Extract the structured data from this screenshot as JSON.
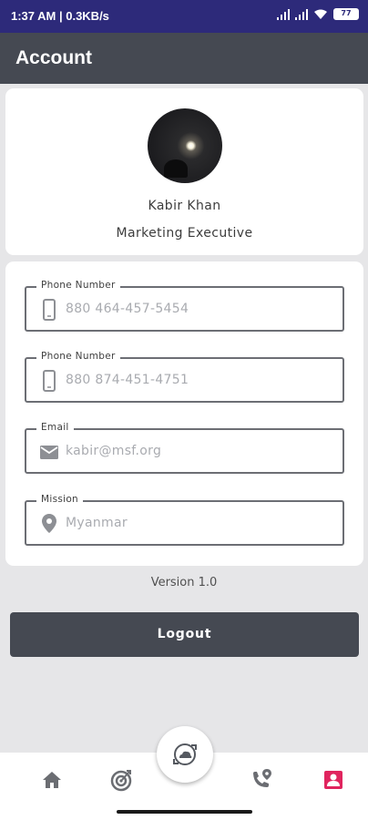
{
  "status_bar": {
    "time": "1:37 AM | 0.3KB/s",
    "battery": "77"
  },
  "app_bar": {
    "title": "Account"
  },
  "profile": {
    "name": "Kabir Khan",
    "role": "Marketing Executive"
  },
  "fields": [
    {
      "label": "Phone Number",
      "value": "880 464-457-5454",
      "icon": "phone-icon"
    },
    {
      "label": "Phone Number",
      "value": "880 874-451-4751",
      "icon": "phone-icon"
    },
    {
      "label": "Email",
      "value": "kabir@msf.org",
      "icon": "email-icon"
    },
    {
      "label": "Mission",
      "value": "Myanmar",
      "icon": "location-pin-icon"
    }
  ],
  "version": "Version 1.0",
  "logout_label": "Logout",
  "nav": {
    "items": [
      "home-icon",
      "target-icon",
      "sync-icon",
      "phone-location-icon",
      "account-icon"
    ],
    "active": "account-icon",
    "active_color": "#e0245e",
    "inactive_color": "#6b6d72"
  }
}
